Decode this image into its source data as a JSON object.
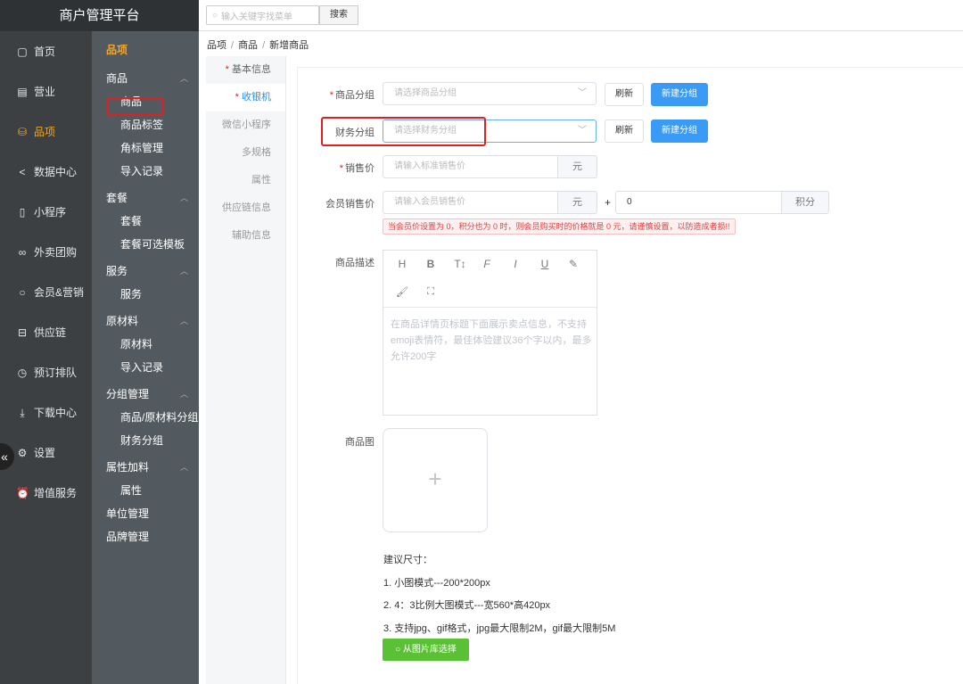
{
  "app": {
    "title": "商户管理平台"
  },
  "topbar": {
    "search_placeholder": "输入关键字找菜单",
    "search_label": "搜索"
  },
  "nav": [
    {
      "label": "首页",
      "icon": "home-icon"
    },
    {
      "label": "营业",
      "icon": "calendar-icon"
    },
    {
      "label": "品项",
      "icon": "bag-icon"
    },
    {
      "label": "数据中心",
      "icon": "share-icon"
    },
    {
      "label": "小程序",
      "icon": "phone-icon"
    },
    {
      "label": "外卖团购",
      "icon": "bike-icon"
    },
    {
      "label": "会员&营销",
      "icon": "user-icon"
    },
    {
      "label": "供应链",
      "icon": "truck-icon"
    },
    {
      "label": "预订排队",
      "icon": "clock-icon"
    },
    {
      "label": "下载中心",
      "icon": "download-icon"
    },
    {
      "label": "设置",
      "icon": "gear-icon"
    },
    {
      "label": "增值服务",
      "icon": "alarm-icon"
    }
  ],
  "subnav": {
    "title": "品项",
    "groups": [
      {
        "label": "商品",
        "items": [
          "商品",
          "商品标签",
          "角标管理",
          "导入记录"
        ]
      },
      {
        "label": "套餐",
        "items": [
          "套餐",
          "套餐可选模板"
        ]
      },
      {
        "label": "服务",
        "items": [
          "服务"
        ]
      },
      {
        "label": "原材料",
        "items": [
          "原材料",
          "导入记录"
        ]
      },
      {
        "label": "分组管理",
        "items": [
          "商品/原材料分组",
          "财务分组"
        ]
      },
      {
        "label": "属性加料",
        "items": [
          "属性"
        ]
      },
      {
        "label": "单位管理",
        "items": []
      },
      {
        "label": "品牌管理",
        "items": []
      }
    ]
  },
  "breadcrumb": [
    "品项",
    "商品",
    "新增商品"
  ],
  "tabs": [
    "基本信息",
    "收银机",
    "微信小程序",
    "多规格",
    "属性",
    "供应链信息",
    "辅助信息"
  ],
  "form": {
    "product_group": {
      "label": "商品分组",
      "placeholder": "请选择商品分组"
    },
    "finance_group": {
      "label": "财务分组",
      "placeholder": "请选择财务分组"
    },
    "refresh_label": "刷新",
    "new_group_label": "新建分组",
    "price": {
      "label": "销售价",
      "placeholder": "请输入标准销售价",
      "unit": "元"
    },
    "member_price": {
      "label": "会员销售价",
      "placeholder": "请输入会员销售价",
      "unit": "元",
      "plus": "+",
      "points_value": "0",
      "points_unit": "积分"
    },
    "warning": "当会员价设置为 0，积分也为 0 时，则会员购买时的价格就是 0 元，请谨慎设置，以防造成者损!!",
    "description": {
      "label": "商品描述",
      "placeholder": "在商品详情页标题下面展示卖点信息，不支持emoji表情符，最佳体验建议36个字以内，最多允许200字"
    },
    "image": {
      "label": "商品图",
      "plus": "+"
    },
    "size_tips": [
      "建议尺寸：",
      "1. 小图模式---200*200px",
      "2. 4：3比例大图模式---宽560*高420px",
      "3. 支持jpg、gif格式，jpg最大限制2M，gif最大限制5M"
    ],
    "library_button": "从图片库选择"
  },
  "editor_tools": [
    "H",
    "B",
    "T↕",
    "F",
    "I",
    "U",
    "✎",
    "🖌",
    "⛶"
  ]
}
